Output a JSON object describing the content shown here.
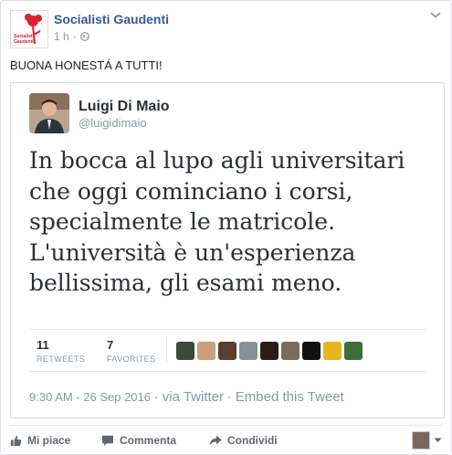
{
  "post": {
    "page_name": "Socialisti Gaudenti",
    "time": "1 h",
    "separator": "·",
    "text": "BUONA HONESTÁ A TUTTI!",
    "logo_text_line1": "Socialisti",
    "logo_text_line2": "Gaudenti"
  },
  "tweet": {
    "author_name": "Luigi Di Maio",
    "handle": "@luigidimaio",
    "lines": [
      "In bocca al lupo agli universitari",
      "che oggi cominciano i corsi,",
      "specialmente le matricole.",
      "L'università è un'esperienza",
      "bellissima, gli esami meno."
    ],
    "retweets_count": "11",
    "retweets_label": "RETWEETS",
    "favorites_count": "7",
    "favorites_label": "FAVORITES",
    "favoriter_colors": [
      "#3b4a3a",
      "#c9a07a",
      "#5b3e2b",
      "#8a8f96",
      "#2a1e1a",
      "#7a6b5a",
      "#111111",
      "#e8b520",
      "#3c6e3c"
    ],
    "timestamp": "9:30 AM - 26 Sep 2016",
    "via": "· via Twitter",
    "embed": "· Embed this Tweet"
  },
  "actions": {
    "like": "Mi piace",
    "comment": "Commenta",
    "share": "Condividi"
  },
  "colors": {
    "link": "#365899",
    "brand_red": "#d8232a",
    "muted": "#90949c"
  }
}
